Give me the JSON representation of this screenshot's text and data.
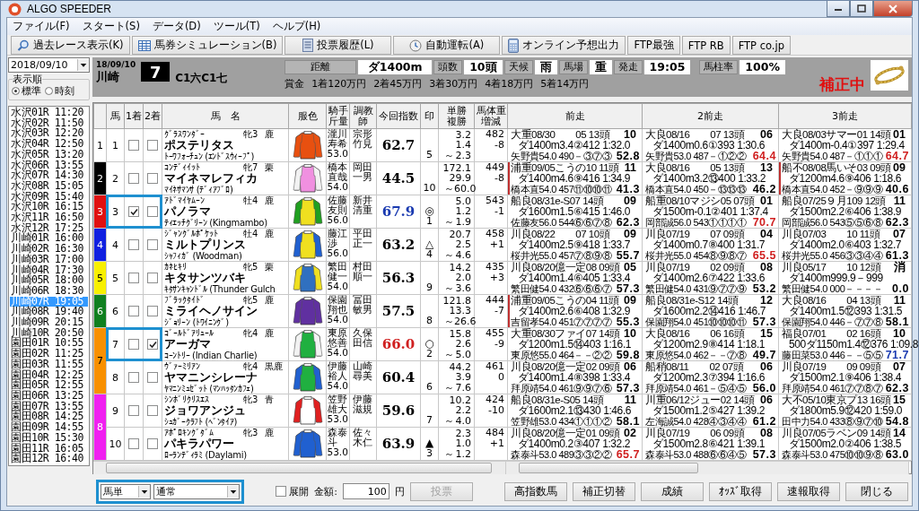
{
  "window": {
    "title": "ALGO SPEEDER"
  },
  "menu": [
    "ファイル(F)",
    "スタート(S)",
    "データ(D)",
    "ツール(T)",
    "ヘルプ(H)"
  ],
  "toolbar": [
    {
      "label": "過去レース表示(K)",
      "kind": "search"
    },
    {
      "label": "馬券シミュレーション(B)",
      "kind": "table"
    },
    {
      "label": "投票履歴(L)",
      "kind": "document"
    },
    {
      "label": "自動運転(A)",
      "kind": "clock"
    },
    {
      "label": "オンライン予想出力",
      "kind": "calculator"
    },
    {
      "label": "FTP最強",
      "kind": "text"
    },
    {
      "label": "FTP RB",
      "kind": "text"
    },
    {
      "label": "FTP co.jp",
      "kind": "text"
    }
  ],
  "sidebar": {
    "date": "2018/09/10",
    "order_label": "表示順",
    "order_options": [
      {
        "label": "標準",
        "selected": true
      },
      {
        "label": "時刻",
        "selected": false
      }
    ],
    "races": [
      {
        "race": "水沢01R",
        "time": "11:20",
        "selected": false
      },
      {
        "race": "水沢02R",
        "time": "11:50",
        "selected": false
      },
      {
        "race": "水沢03R",
        "time": "12:20",
        "selected": false
      },
      {
        "race": "水沢04R",
        "time": "12:50",
        "selected": false
      },
      {
        "race": "水沢05R",
        "time": "13:20",
        "selected": false
      },
      {
        "race": "水沢06R",
        "time": "13:55",
        "selected": false
      },
      {
        "race": "水沢07R",
        "time": "14:30",
        "selected": false
      },
      {
        "race": "水沢08R",
        "time": "15:05",
        "selected": false
      },
      {
        "race": "水沢09R",
        "time": "15:40",
        "selected": false
      },
      {
        "race": "水沢10R",
        "time": "16:15",
        "selected": false
      },
      {
        "race": "水沢11R",
        "time": "16:50",
        "selected": false
      },
      {
        "race": "水沢12R",
        "time": "17:25",
        "selected": false
      },
      {
        "race": "川崎01R",
        "time": "16:00",
        "selected": false
      },
      {
        "race": "川崎02R",
        "time": "16:30",
        "selected": false
      },
      {
        "race": "川崎03R",
        "time": "17:00",
        "selected": false
      },
      {
        "race": "川崎04R",
        "time": "17:30",
        "selected": false
      },
      {
        "race": "川崎05R",
        "time": "18:00",
        "selected": false
      },
      {
        "race": "川崎06R",
        "time": "18:30",
        "selected": false
      },
      {
        "race": "川崎07R",
        "time": "19:05",
        "selected": true
      },
      {
        "race": "川崎08R",
        "time": "19:40",
        "selected": false
      },
      {
        "race": "川崎09R",
        "time": "20:15",
        "selected": false
      },
      {
        "race": "川崎10R",
        "time": "20:50",
        "selected": false
      },
      {
        "race": "園田01R",
        "time": "10:55",
        "selected": false
      },
      {
        "race": "園田02R",
        "time": "11:25",
        "selected": false
      },
      {
        "race": "園田03R",
        "time": "11:55",
        "selected": false
      },
      {
        "race": "園田04R",
        "time": "12:25",
        "selected": false
      },
      {
        "race": "園田05R",
        "time": "12:55",
        "selected": false
      },
      {
        "race": "園田06R",
        "time": "13:25",
        "selected": false
      },
      {
        "race": "園田07R",
        "time": "13:55",
        "selected": false
      },
      {
        "race": "園田08R",
        "time": "14:25",
        "selected": false
      },
      {
        "race": "園田09R",
        "time": "14:55",
        "selected": false
      },
      {
        "race": "園田10R",
        "time": "15:30",
        "selected": false
      },
      {
        "race": "園田11R",
        "time": "16:05",
        "selected": false
      },
      {
        "race": "園田12R",
        "time": "16:40",
        "selected": false
      }
    ]
  },
  "race": {
    "date": "18/09/10",
    "venue": "川崎",
    "number": "7",
    "class": "C1六C1七",
    "info": [
      {
        "label": "距離",
        "value": "ダ1400m"
      },
      {
        "label": "頭数",
        "value": "10頭"
      },
      {
        "label": "天候",
        "value": "雨"
      },
      {
        "label": "馬場",
        "value": "重"
      },
      {
        "label": "発走",
        "value": "19:05"
      },
      {
        "label": "馬柱率",
        "value": "100%"
      }
    ],
    "prizes": [
      "賞金",
      "1着120万円",
      "2着45万円",
      "3着30万円",
      "4着18万円",
      "5着14万円"
    ],
    "status": "補正中"
  },
  "table": {
    "columns": [
      "馬",
      "1着",
      "2着",
      "馬　名",
      "服色",
      "騎手斤量",
      "調教師",
      "今回指数",
      "印",
      "単勝複勝",
      "馬体重増減",
      "前走",
      "2前走",
      "3前走"
    ],
    "frames": [
      {
        "number": "1",
        "color": "#ffffff",
        "horses": [
          {
            "number": "1",
            "first": false,
            "second": false,
            "selected": false,
            "sire": "ｸﾞﾗｽﾜﾝﾀﾞｰ",
            "name": "ポステリタス",
            "dam": "ﾄｰﾜﾌｫｰﾁｭﾝ (ｴﾝﾄﾞｽｳｨｰﾌﾟ)",
            "sex_age": "牝3",
            "coat": "鹿",
            "silks": {
              "color": "#e85010",
              "sleeves": {
                "color": "#e85010"
              }
            },
            "jockey": "瀧川寿希",
            "weight": "53.0",
            "trainer": "宗形竹見",
            "index": {
              "value": "62.7",
              "color": "#000000"
            },
            "popularity": "5",
            "odds": [
              "3.2",
              "1.4",
              "～",
              "2.3"
            ],
            "body_weight": "482",
            "weight_change": "-8",
            "prev": [
              {
                "line1": "大重08/30　　05 13頭",
                "result": "10",
                "line2": "ダ1400m3.4②412 1:32.0",
                "line3": "矢野貴54.0 490－③⑦③",
                "score": {
                  "value": "52.8",
                  "color": "#000000"
                },
                "marked": false
              },
              {
                "line1": "大良08/16　　07 13頭",
                "result": "06",
                "line2": "ダ1400m0.6①393 1:30.6",
                "line3": "矢野貴53.0 487－①②②",
                "score": {
                  "value": "64.4",
                  "color": "#d02020"
                },
                "marked": false
              },
              {
                "line1": "大良08/03サマー01 14頭",
                "result": "01",
                "line2": "ダ1400m-0.4①397 1:29.4",
                "line3": "矢野貴54.0 487－①①①",
                "score": {
                  "value": "64.7",
                  "color": "#d02020"
                },
                "marked": false
              }
            ]
          }
        ]
      },
      {
        "number": "2",
        "color": "#000000",
        "horses": [
          {
            "number": "2",
            "first": false,
            "second": false,
            "selected": false,
            "sire": "ｺﾝﾃﾞｨｲｯﾄ",
            "name": "マイネマレフィカ",
            "dam": "ﾏｲﾈｻﾏﾝｻ (ﾃﾞｨｱﾌﾞﾛ)",
            "sex_age": "牝7",
            "coat": "栗",
            "silks": {
              "color": "#f090e0",
              "sleeves": {
                "color": "#f2f2f2"
              }
            },
            "jockey": "橋本直哉",
            "weight": "54.0",
            "trainer": "岡田一男",
            "index": {
              "value": "44.5",
              "color": "#000000"
            },
            "popularity": "10",
            "odds": [
              "172.1",
              "29.9",
              "～",
              "60.0"
            ],
            "body_weight": "449",
            "weight_change": "-8",
            "prev": [
              {
                "line1": "浦重09/05こうの10 11頭",
                "result": "11",
                "line2": "ダ1400m4.6⑨416 1:34.9",
                "line3": "橋本直54.0 457⑪⑩⑩⑪",
                "score": {
                  "value": "41.3",
                  "color": "#000000"
                },
                "marked": true
              },
              {
                "line1": "大良08/16　　05 13頭",
                "result": "13",
                "line2": "ダ1400m3.2⑬400 1:33.2",
                "line3": "橋本直54.0 450－⑬⑬⑬",
                "score": {
                  "value": "46.2",
                  "color": "#000000"
                },
                "marked": false
              },
              {
                "line1": "船不08/08馬いそ03 09頭",
                "result": "09",
                "line2": "ダ1200m4.6⑨406 1:18.6",
                "line3": "橋本直54.0 452－⑨⑨⑨",
                "score": {
                  "value": "40.6",
                  "color": "#000000"
                },
                "marked": true
              }
            ]
          }
        ]
      },
      {
        "number": "3",
        "color": "#e01010",
        "horses": [
          {
            "number": "3",
            "first": true,
            "second": false,
            "selected": true,
            "sire": "ｱﾄﾞﾏｲﾔﾑｰﾝ",
            "name": "パノラマ",
            "dam": "ﾃｨｴｯﾁｸﾞﾘｰﾝ (Kingmambo)",
            "sex_age": "牡4",
            "coat": "鹿",
            "silks": {
              "color": "#f0e020",
              "sleeves": {
                "color": "#20a020"
              }
            },
            "jockey": "佐藤友則",
            "weight": "56.0",
            "trainer": "新井清重",
            "index": {
              "value": "67.9",
              "color": "#1a3ab0"
            },
            "mark": "◎",
            "popularity": "1",
            "odds": [
              "5.0",
              "1.2",
              "～",
              "1.9"
            ],
            "body_weight": "543",
            "weight_change": "-1",
            "prev": [
              {
                "line1": "船良08/31e-S07 14頭",
                "result": "09",
                "line2": "ダ1600m1.5⑥415 1:46.0",
                "line3": "佐藤友56.0 544⑥⑥⑦⑧",
                "score": {
                  "value": "62.3",
                  "color": "#000000"
                },
                "marked": false
              },
              {
                "line1": "船重08/10マジシ05 07頭",
                "result": "01",
                "line2": "ダ1500m-0.1②401 1:37.4",
                "line3": "岡部誠56.0 543①①①①",
                "score": {
                  "value": "70.7",
                  "color": "#d02020"
                },
                "marked": false
              },
              {
                "line1": "船良07/25９月109 12頭",
                "result": "11",
                "line2": "ダ1500m2.2⑥406 1:38.9",
                "line3": "岡部誠56.0 543⑤⑤⑥⑧",
                "score": {
                  "value": "62.3",
                  "color": "#000000"
                },
                "marked": false
              }
            ]
          }
        ]
      },
      {
        "number": "4",
        "color": "#1020e0",
        "horses": [
          {
            "number": "4",
            "first": false,
            "second": false,
            "selected": false,
            "sire": "ｼﾞｬﾝｸﾞﾙﾎﾟｹｯﾄ",
            "name": "ミルトプリンス",
            "dam": "ｼｬﾌｨｶﾞ (Woodman)",
            "sex_age": "牡4",
            "coat": "鹿",
            "silks": {
              "color": "#f0e020",
              "sleeves": {
                "color": "#2060d0"
              }
            },
            "jockey": "藤江渉",
            "weight": "56.0",
            "trainer": "平田正一",
            "index": {
              "value": "63.2",
              "color": "#000000"
            },
            "mark": "△",
            "popularity": "4",
            "odds": [
              "20.7",
              "2.5",
              "～",
              "4.6"
            ],
            "body_weight": "458",
            "weight_change": "+1",
            "prev": [
              {
                "line1": "川良08/22　　07 10頭",
                "result": "09",
                "line2": "ダ1400m2.5⑨418 1:33.7",
                "line3": "桜井光55.0 457⑦⑧⑨⑧",
                "score": {
                  "value": "55.7",
                  "color": "#000000"
                },
                "marked": false
              },
              {
                "line1": "川良07/19　　07 09頭",
                "result": "04",
                "line2": "ダ1400m0.7⑧400 1:31.7",
                "line3": "桜井光55.0 454⑧⑨⑧⑦",
                "score": {
                  "value": "65.5",
                  "color": "#d02020"
                },
                "marked": false
              },
              {
                "line1": "川良07/03　　10 11頭",
                "result": "07",
                "line2": "ダ1400m2.0⑥403 1:32.7",
                "line3": "桜井光55.0 456③③④④",
                "score": {
                  "value": "61.3",
                  "color": "#000000"
                },
                "marked": false
              }
            ]
          }
        ]
      },
      {
        "number": "5",
        "color": "#f8f000",
        "horses": [
          {
            "number": "5",
            "first": false,
            "second": false,
            "selected": false,
            "sire": "ｶﾈﾋｷﾘ",
            "name": "キタサンツバキ",
            "dam": "ｷﾀｻﾝｷｬﾝﾄﾞﾙ (Thunder Gulch",
            "sex_age": "牝5",
            "coat": "栗",
            "silks": {
              "color": "#3070c0",
              "sleeves": {
                "color": "#f0e020"
              }
            },
            "jockey": "繁田健一",
            "weight": "54.0",
            "trainer": "村田順一",
            "index": {
              "value": "56.3",
              "color": "#000000"
            },
            "popularity": "9",
            "odds": [
              "14.2",
              "2.0",
              "～",
              "3.6"
            ],
            "body_weight": "435",
            "weight_change": "+3",
            "prev": [
              {
                "line1": "川良08/20億一定08 09頭",
                "result": "05",
                "line2": "ダ1400m1.4⑥405 1:33.4",
                "line3": "繁田健54.0 432⑥⑥⑥⑦",
                "score": {
                  "value": "57.3",
                  "color": "#000000"
                },
                "marked": false
              },
              {
                "line1": "川良07/19　　02 09頭",
                "result": "08",
                "line2": "ダ1400m2.6⑦422 1:33.6",
                "line3": "繁田健54.0 431⑨⑦⑦⑨",
                "score": {
                  "value": "53.2",
                  "color": "#000000"
                },
                "marked": false
              },
              {
                "line1": "川良05/17　　10 12頭",
                "result": "消",
                "line2": "ダ1400m999.9－999",
                "line3": "繁田健54.0 000－－－－",
                "score": {
                  "value": "0.0",
                  "color": "#000000"
                },
                "marked": false
              }
            ]
          }
        ]
      },
      {
        "number": "6",
        "color": "#108020",
        "horses": [
          {
            "number": "6",
            "first": false,
            "second": false,
            "selected": false,
            "sire": "ﾌﾞﾗｯｸﾀｲﾄﾞ",
            "name": "ミライヘノサイン",
            "dam": "ｼﾞｮﾘｰﾝ (ﾄﾜｲﾆﾝｸﾞ)",
            "sex_age": "牝5",
            "coat": "鹿",
            "silks": {
              "color": "#6030a0",
              "sleeves": {
                "color": "#6030a0"
              }
            },
            "jockey": "保園翔也",
            "weight": "54.0",
            "trainer": "冨田敏男",
            "index": {
              "value": "57.5",
              "color": "#000000"
            },
            "popularity": "8",
            "odds": [
              "121.8",
              "13.3",
              "～",
              "26.6"
            ],
            "body_weight": "444",
            "weight_change": "-7",
            "prev": [
              {
                "line1": "浦重09/05こうの04 11頭",
                "result": "09",
                "line2": "ダ1400m2.6⑥408 1:32.9",
                "line3": "吉留孝54.0 451⑦⑦⑦⑦",
                "score": {
                  "value": "55.3",
                  "color": "#000000"
                },
                "marked": true
              },
              {
                "line1": "船良08/31e-S12 14頭",
                "result": "12",
                "line2": "ダ1600m2.2⑭416 1:46.7",
                "line3": "保園翔54.0 451⑩⑩⑩⑪",
                "score": {
                  "value": "57.3",
                  "color": "#000000"
                },
                "marked": false
              },
              {
                "line1": "大良08/16　　04 13頭",
                "result": "11",
                "line2": "ダ1400m1.5⑫393 1:31.5",
                "line3": "保園翔54.0 446－⑦⑦⑧",
                "score": {
                  "value": "58.1",
                  "color": "#000000"
                },
                "marked": false
              }
            ]
          }
        ]
      },
      {
        "number": "7",
        "color": "#f89000",
        "horses": [
          {
            "number": "7",
            "first": false,
            "second": true,
            "selected": true,
            "sire": "ｺﾞｰﾙﾄﾞｱﾘｭｰﾙ",
            "name": "アーガマ",
            "dam": "ｺｰﾝﾄﾘｰ (Indian Charlie)",
            "sex_age": "牝4",
            "coat": "鹿",
            "silks": {
              "color": "#20b040",
              "sleeves": {
                "color": "#f2f2f2"
              }
            },
            "jockey": "東原悠善",
            "weight": "54.0",
            "trainer": "久保田信",
            "index": {
              "value": "66.0",
              "color": "#d02020"
            },
            "mark": "○",
            "popularity": "2",
            "odds": [
              "15.8",
              "2.6",
              "～",
              "5.0"
            ],
            "body_weight": "455",
            "weight_change": "-9",
            "prev": [
              {
                "line1": "大重08/30ファイ07 14頭",
                "result": "10",
                "line2": "ダ1200m1.5⑭403 1:16.1",
                "line3": "東原悠55.0 464－－②②",
                "score": {
                  "value": "59.8",
                  "color": "#000000"
                },
                "marked": false
              },
              {
                "line1": "大良08/16　　06 16頭",
                "result": "15",
                "line2": "ダ1200m2.9⑧414 1:18.1",
                "line3": "東原悠54.0 462－－⑦⑧",
                "score": {
                  "value": "49.7",
                  "color": "#000000"
                },
                "marked": false
              },
              {
                "line1": "福良07/01　　02 16頭",
                "result": "10",
                "line2": "500ダ1150m1.4⑫376 1:09.8",
                "line3": "藤田菜53.0 446－－⑤⑤",
                "score": {
                  "value": "71.7",
                  "color": "#1a3ab0"
                },
                "marked": false
              }
            ]
          },
          {
            "number": "8",
            "first": false,
            "second": false,
            "selected": false,
            "sire": "ｳﾞｧｰﾐﾘｱﾝ",
            "name": "ヤマニンシレーナ",
            "dam": "ﾔﾏﾆﾝﾐｭｾﾞｯﾄ (ﾏﾝﾊｯﾀﾝｶﾌｪ)",
            "sex_age": "牝4",
            "coat": "黒鹿",
            "silks": {
              "color": "#20b040",
              "sleeves": {
                "color": "#2060d0"
              }
            },
            "jockey": "伊藤裕人",
            "weight": "54.0",
            "trainer": "山崎尋美",
            "index": {
              "value": "60.4",
              "color": "#000000"
            },
            "popularity": "6",
            "odds": [
              "44.2",
              "3.9",
              "～",
              "7.6"
            ],
            "body_weight": "461",
            "weight_change": "0",
            "prev": [
              {
                "line1": "川良08/20億一定02 09頭",
                "result": "06",
                "line2": "ダ1400m1.4⑧398 1:33.4",
                "line3": "拜原靖54.0 461⑨⑨⑦⑥",
                "score": {
                  "value": "57.3",
                  "color": "#000000"
                },
                "marked": false
              },
              {
                "line1": "船稍08/11　　02 07頭",
                "result": "06",
                "line2": "ダ1200m2.3⑦394 1:16.6",
                "line3": "拜原靖54.0 461－⑤④⑤",
                "score": {
                  "value": "56.0",
                  "color": "#000000"
                },
                "marked": false
              },
              {
                "line1": "川良07/19　　09 09頭",
                "result": "07",
                "line2": "ダ1500m2.1⑨406 1:38.4",
                "line3": "拜原靖54.0 461⑦⑦⑧⑦",
                "score": {
                  "value": "62.3",
                  "color": "#000000"
                },
                "marked": false
              }
            ]
          }
        ]
      },
      {
        "number": "8",
        "color": "#f020f0",
        "horses": [
          {
            "number": "9",
            "first": false,
            "second": false,
            "selected": false,
            "sire": "ｼﾝﾎﾞﾘｸﾘｽｴｽ",
            "name": "ジョワアンジュ",
            "dam": "ｼｭｶﾞｰｸﾗﾌﾄ (ﾍﾞﾝﾀｲｱ)",
            "sex_age": "牝3",
            "coat": "青",
            "silks": {
              "color": "#ffffff",
              "sleeves": {
                "color": "#e02020"
              }
            },
            "jockey": "笠野雄大",
            "weight": "53.0",
            "trainer": "伊藤滋規",
            "index": {
              "value": "59.6",
              "color": "#000000"
            },
            "popularity": "7",
            "odds": [
              "10.2",
              "2.2",
              "～",
              "4.0"
            ],
            "body_weight": "424",
            "weight_change": "-10",
            "prev": [
              {
                "line1": "船良08/31e-S05 14頭",
                "result": "11",
                "line2": "ダ1600m2.1⑬430 1:46.6",
                "line3": "笠野雄53.0 434①①①②",
                "score": {
                  "value": "58.1",
                  "color": "#000000"
                },
                "marked": false
              },
              {
                "line1": "川重06/12ジュー02 14頭",
                "result": "06",
                "line2": "ダ1500m1.2⑤427 1:39.2",
                "line3": "左海誠54.0 428④③④④",
                "score": {
                  "value": "61.2",
                  "color": "#000000"
                },
                "marked": false
              },
              {
                "line1": "大不05/10東京プ13 16頭",
                "result": "15",
                "line2": "ダ1800m5.9⑫420 1:59.0",
                "line3": "田中力54.0 433⑧⑨⑦⑩",
                "score": {
                  "value": "54.8",
                  "color": "#000000"
                },
                "marked": false
              }
            ]
          },
          {
            "number": "10",
            "first": false,
            "second": false,
            "selected": false,
            "sire": "ｱﾎﾟﾛｷﾝｸﾞﾀﾞﾑ",
            "name": "パキラパワー",
            "dam": "ﾛｰﾗﾝﾃﾞｨﾗﾐ (Daylami)",
            "sex_age": "牝3",
            "coat": "鹿",
            "silks": {
              "color": "#2060d0",
              "sleeves": {
                "color": "#2060d0"
              }
            },
            "jockey": "森泰斗",
            "weight": "53.0",
            "trainer": "佐々木仁",
            "index": {
              "value": "63.9",
              "color": "#000000"
            },
            "mark": "▲",
            "popularity": "3",
            "odds": [
              "2.3",
              "1.0",
              "～",
              "1.2"
            ],
            "body_weight": "484",
            "weight_change": "+1",
            "prev": [
              {
                "line1": "川良08/20億一定01 09頭",
                "result": "02",
                "line2": "ダ1400m0.2③407 1:32.2",
                "line3": "森泰斗53.0 489③③②②",
                "score": {
                  "value": "65.7",
                  "color": "#d02020"
                },
                "marked": false
              },
              {
                "line1": "川良07/19　　06 09頭",
                "result": "08",
                "line2": "ダ1500m2.8⑥421 1:39.1",
                "line3": "森泰斗53.0 488⑥⑥④⑤",
                "score": {
                  "value": "57.3",
                  "color": "#000000"
                },
                "marked": false
              },
              {
                "line1": "川良07/05ラベン09 14頭",
                "result": "14",
                "line2": "ダ1500m2.0②406 1:38.5",
                "line3": "森泰斗53.0 475⑩⑩⑨⑧",
                "score": {
                  "value": "63.0",
                  "color": "#000000"
                },
                "marked": false
              }
            ]
          }
        ]
      }
    ]
  },
  "footer": {
    "bet_type": "馬単",
    "bet_mode": "通常",
    "expand": {
      "label": "展開",
      "checked": false
    },
    "amount_label": "金額:",
    "amount": "100",
    "currency": "円",
    "vote": {
      "label": "投票",
      "disabled": true
    },
    "buttons": [
      "高指数馬",
      "補正切替",
      "成績",
      "ｵｯｽﾞ取得",
      "速報取得",
      "閉じる"
    ]
  }
}
